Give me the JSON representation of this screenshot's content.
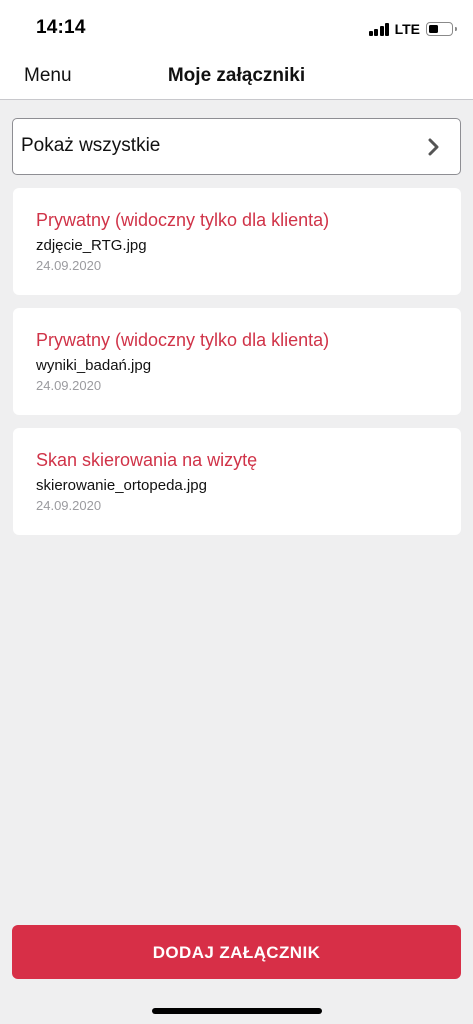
{
  "status_bar": {
    "time": "14:14",
    "network": "LTE",
    "signal_bars": 4,
    "battery_level": 0.45
  },
  "nav": {
    "back_label": "Menu",
    "title": "Moje załączniki"
  },
  "filter": {
    "label": "Pokaż wszystkie",
    "icon": "chevron-right-icon"
  },
  "attachments": [
    {
      "category": "Prywatny (widoczny tylko dla klienta)",
      "filename": "zdjęcie_RTG.jpg",
      "date": "24.09.2020"
    },
    {
      "category": "Prywatny (widoczny tylko dla klienta)",
      "filename": "wyniki_badań.jpg",
      "date": "24.09.2020"
    },
    {
      "category": "Skan skierowania na wizytę",
      "filename": "skierowanie_ortopeda.jpg",
      "date": "24.09.2020"
    }
  ],
  "add_button": {
    "label": "DODAJ ZAŁĄCZNIK"
  },
  "colors": {
    "accent": "#d72f47",
    "category_text": "#d03348",
    "background": "#efeff0",
    "date_text": "#9b9b9f"
  }
}
